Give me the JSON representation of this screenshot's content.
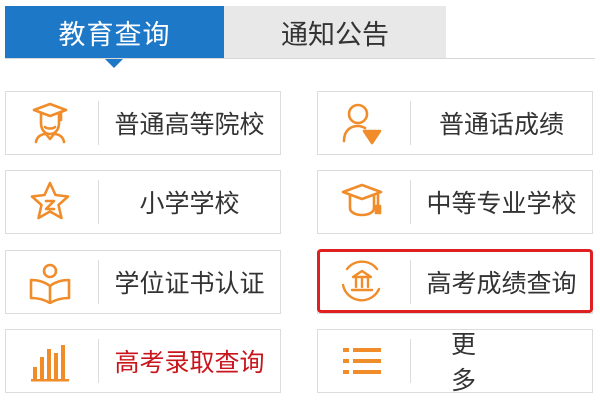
{
  "tabs": {
    "active": "教育查询",
    "inactive": "通知公告"
  },
  "items": [
    {
      "label": "普通高等院校",
      "icon": "graduate-icon"
    },
    {
      "label": "普通话成绩",
      "icon": "speaker-person-icon"
    },
    {
      "label": "小学学校",
      "icon": "star-badge-icon"
    },
    {
      "label": "中等专业学校",
      "icon": "mortarboard-icon"
    },
    {
      "label": "学位证书认证",
      "icon": "open-book-icon"
    },
    {
      "label": "高考成绩查询",
      "icon": "institution-icon"
    },
    {
      "label": "高考录取查询",
      "icon": "bar-chart-icon"
    },
    {
      "label": "更 多",
      "icon": "list-icon"
    }
  ],
  "colors": {
    "tab_active_bg": "#1e78c8",
    "icon_orange": "#f08c2a",
    "highlight_red": "#e02020",
    "label_red": "#c8161d"
  }
}
